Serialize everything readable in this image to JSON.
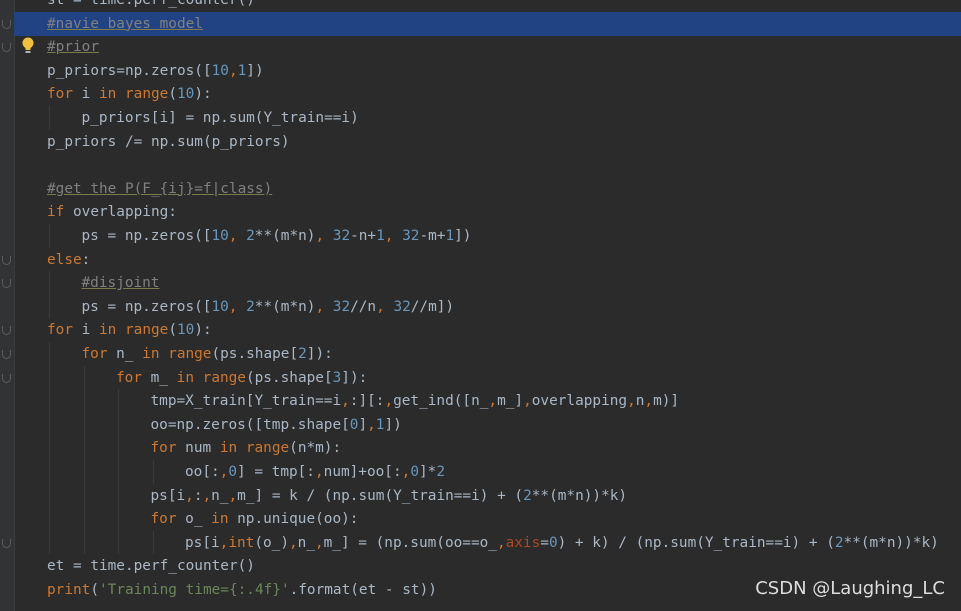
{
  "editor": {
    "language": "python",
    "lines": [
      {
        "indent": 0,
        "selected": false,
        "tokens": [
          [
            "st = time.perf_counter()",
            "p"
          ]
        ]
      },
      {
        "indent": 0,
        "selected": true,
        "tokens": [
          [
            "#navie bayes model",
            "c"
          ]
        ]
      },
      {
        "indent": 0,
        "selected": false,
        "tokens": [
          [
            "#prior",
            "c"
          ]
        ]
      },
      {
        "indent": 0,
        "selected": false,
        "tokens": [
          [
            "p_priors=np.zeros([",
            "p"
          ],
          [
            "10",
            "n"
          ],
          [
            ",",
            "k"
          ],
          [
            "1",
            "n"
          ],
          [
            "])",
            "p"
          ]
        ]
      },
      {
        "indent": 0,
        "selected": false,
        "tokens": [
          [
            "for",
            "k"
          ],
          [
            " i ",
            "p"
          ],
          [
            "in",
            "k"
          ],
          [
            " ",
            "p"
          ],
          [
            "range",
            "k"
          ],
          [
            "(",
            "p"
          ],
          [
            "10",
            "n"
          ],
          [
            "):",
            "p"
          ]
        ]
      },
      {
        "indent": 1,
        "selected": false,
        "tokens": [
          [
            "p_priors[i] = np.sum(Y_train==i)",
            "p"
          ]
        ]
      },
      {
        "indent": 0,
        "selected": false,
        "tokens": [
          [
            "p_priors /= np.sum(p_priors)",
            "p"
          ]
        ]
      },
      {
        "indent": 0,
        "selected": false,
        "tokens": []
      },
      {
        "indent": 0,
        "selected": false,
        "tokens": [
          [
            "#get the P(F_{ij}=f|class)",
            "c"
          ]
        ]
      },
      {
        "indent": 0,
        "selected": false,
        "tokens": [
          [
            "if",
            "k"
          ],
          [
            " overlapping:",
            "p"
          ]
        ]
      },
      {
        "indent": 1,
        "selected": false,
        "tokens": [
          [
            "ps = np.zeros([",
            "p"
          ],
          [
            "10",
            "n"
          ],
          [
            ", ",
            "k"
          ],
          [
            "2",
            "n"
          ],
          [
            "**(m*n)",
            "p"
          ],
          [
            ", ",
            "k"
          ],
          [
            "32",
            "n"
          ],
          [
            "-n+",
            "p"
          ],
          [
            "1",
            "n"
          ],
          [
            ", ",
            "k"
          ],
          [
            "32",
            "n"
          ],
          [
            "-m+",
            "p"
          ],
          [
            "1",
            "n"
          ],
          [
            "])",
            "p"
          ]
        ]
      },
      {
        "indent": 0,
        "selected": false,
        "tokens": [
          [
            "else",
            "k"
          ],
          [
            ":",
            "p"
          ]
        ]
      },
      {
        "indent": 1,
        "selected": false,
        "tokens": [
          [
            "#disjoint",
            "c"
          ]
        ]
      },
      {
        "indent": 1,
        "selected": false,
        "tokens": [
          [
            "ps = np.zeros([",
            "p"
          ],
          [
            "10",
            "n"
          ],
          [
            ", ",
            "k"
          ],
          [
            "2",
            "n"
          ],
          [
            "**(m*n)",
            "p"
          ],
          [
            ", ",
            "k"
          ],
          [
            "32",
            "n"
          ],
          [
            "//n",
            "p"
          ],
          [
            ", ",
            "k"
          ],
          [
            "32",
            "n"
          ],
          [
            "//m])",
            "p"
          ]
        ]
      },
      {
        "indent": 0,
        "selected": false,
        "tokens": [
          [
            "for",
            "k"
          ],
          [
            " i ",
            "p"
          ],
          [
            "in",
            "k"
          ],
          [
            " ",
            "p"
          ],
          [
            "range",
            "k"
          ],
          [
            "(",
            "p"
          ],
          [
            "10",
            "n"
          ],
          [
            "):",
            "p"
          ]
        ]
      },
      {
        "indent": 1,
        "selected": false,
        "tokens": [
          [
            "for",
            "k"
          ],
          [
            " n_ ",
            "p"
          ],
          [
            "in",
            "k"
          ],
          [
            " ",
            "p"
          ],
          [
            "range",
            "k"
          ],
          [
            "(ps.shape[",
            "p"
          ],
          [
            "2",
            "n"
          ],
          [
            "]):",
            "p"
          ]
        ]
      },
      {
        "indent": 2,
        "selected": false,
        "tokens": [
          [
            "for",
            "k"
          ],
          [
            " m_ ",
            "p"
          ],
          [
            "in",
            "k"
          ],
          [
            " ",
            "p"
          ],
          [
            "range",
            "k"
          ],
          [
            "(ps.shape[",
            "p"
          ],
          [
            "3",
            "n"
          ],
          [
            "]):",
            "p"
          ]
        ]
      },
      {
        "indent": 3,
        "selected": false,
        "tokens": [
          [
            "tmp=X_train[Y_train==i",
            "p"
          ],
          [
            ",",
            "k"
          ],
          [
            ":][:",
            "p"
          ],
          [
            ",",
            "k"
          ],
          [
            "get_ind([n_",
            "p"
          ],
          [
            ",",
            "k"
          ],
          [
            "m_]",
            "p"
          ],
          [
            ",",
            "k"
          ],
          [
            "overlapping",
            "p"
          ],
          [
            ",",
            "k"
          ],
          [
            "n",
            "p"
          ],
          [
            ",",
            "k"
          ],
          [
            "m)]",
            "p"
          ]
        ]
      },
      {
        "indent": 3,
        "selected": false,
        "tokens": [
          [
            "oo=np.zeros([tmp.shape[",
            "p"
          ],
          [
            "0",
            "n"
          ],
          [
            "]",
            "p"
          ],
          [
            ",",
            "k"
          ],
          [
            "1",
            "n"
          ],
          [
            "])",
            "p"
          ]
        ]
      },
      {
        "indent": 3,
        "selected": false,
        "tokens": [
          [
            "for",
            "k"
          ],
          [
            " num ",
            "p"
          ],
          [
            "in",
            "k"
          ],
          [
            " ",
            "p"
          ],
          [
            "range",
            "k"
          ],
          [
            "(n*m):",
            "p"
          ]
        ]
      },
      {
        "indent": 4,
        "selected": false,
        "tokens": [
          [
            "oo[:",
            "p"
          ],
          [
            ",",
            "k"
          ],
          [
            "0",
            "n"
          ],
          [
            "] = tmp[:",
            "p"
          ],
          [
            ",",
            "k"
          ],
          [
            "num]+oo[:",
            "p"
          ],
          [
            ",",
            "k"
          ],
          [
            "0",
            "n"
          ],
          [
            "]*",
            "p"
          ],
          [
            "2",
            "n"
          ]
        ]
      },
      {
        "indent": 3,
        "selected": false,
        "tokens": [
          [
            "ps[i",
            "p"
          ],
          [
            ",",
            "k"
          ],
          [
            ":",
            "p"
          ],
          [
            ",",
            "k"
          ],
          [
            "n_",
            "p"
          ],
          [
            ",",
            "k"
          ],
          [
            "m_] = k / (np.sum(Y_train==i) + (",
            "p"
          ],
          [
            "2",
            "n"
          ],
          [
            "**(m*n))*k)",
            "p"
          ]
        ]
      },
      {
        "indent": 3,
        "selected": false,
        "tokens": [
          [
            "for",
            "k"
          ],
          [
            " o_ ",
            "p"
          ],
          [
            "in",
            "k"
          ],
          [
            " np.unique(oo):",
            "p"
          ]
        ]
      },
      {
        "indent": 4,
        "selected": false,
        "tokens": [
          [
            "ps[i",
            "p"
          ],
          [
            ",",
            "k"
          ],
          [
            "int",
            "k"
          ],
          [
            "(o_)",
            "p"
          ],
          [
            ",",
            "k"
          ],
          [
            "n_",
            "p"
          ],
          [
            ",",
            "k"
          ],
          [
            "m_] = (np.sum(oo==o_",
            "p"
          ],
          [
            ",",
            "k"
          ],
          [
            "axis",
            "a"
          ],
          [
            "=",
            "p"
          ],
          [
            "0",
            "n"
          ],
          [
            ") + k) / (np.sum(Y_train==i) + (",
            "p"
          ],
          [
            "2",
            "n"
          ],
          [
            "**(m*n))*k)",
            "p"
          ]
        ]
      },
      {
        "indent": 0,
        "selected": false,
        "tokens": [
          [
            "et = time.perf_counter()",
            "p"
          ]
        ]
      },
      {
        "indent": 0,
        "selected": false,
        "tokens": [
          [
            "print",
            "k"
          ],
          [
            "(",
            "p"
          ],
          [
            "'Training time={:.4f}'",
            "s"
          ],
          [
            ".format(et - st))",
            "p"
          ]
        ]
      }
    ]
  },
  "icons": {
    "intention_bulb": "lightbulb-icon",
    "fold_marker": "fold-icon"
  },
  "watermark": {
    "text": "CSDN @Laughing_LC"
  },
  "colors": {
    "background": "#2b2b2b",
    "selection": "#214283",
    "keyword": "#cc7832",
    "number": "#6897bb",
    "string": "#6a8759",
    "comment": "#808080",
    "plain": "#a9b7c6"
  }
}
